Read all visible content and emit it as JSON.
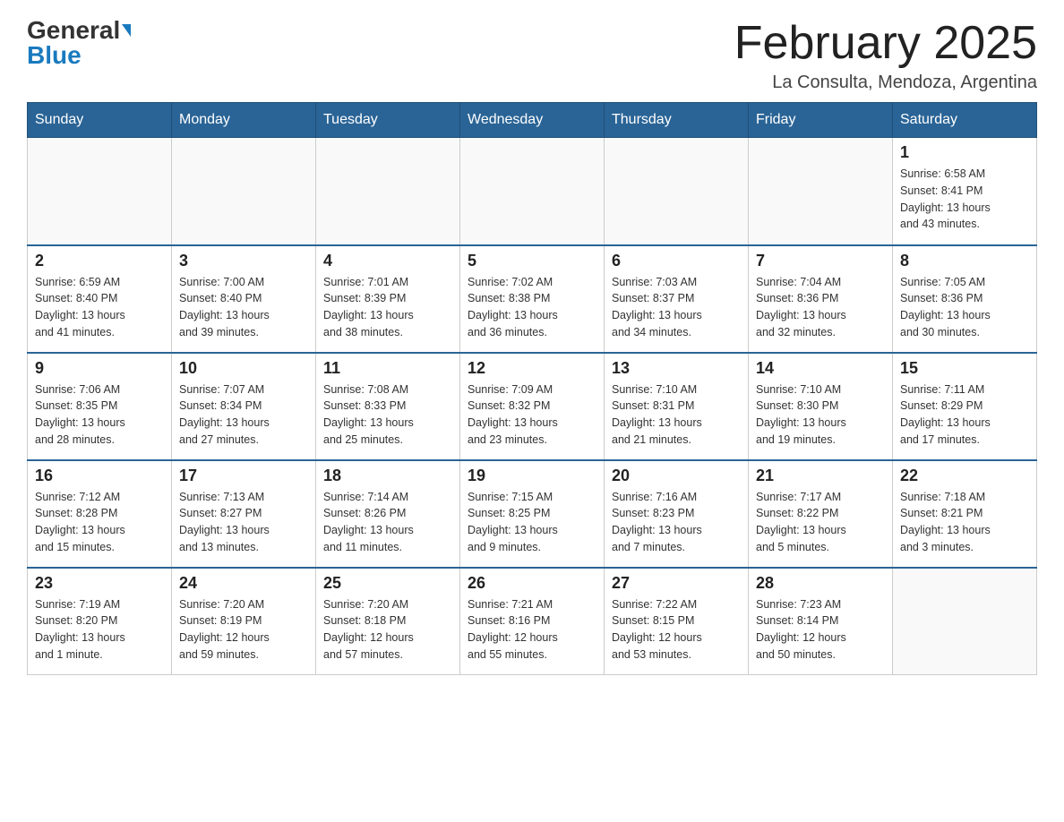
{
  "header": {
    "logo_general": "General",
    "logo_blue": "Blue",
    "title": "February 2025",
    "subtitle": "La Consulta, Mendoza, Argentina"
  },
  "days_of_week": [
    "Sunday",
    "Monday",
    "Tuesday",
    "Wednesday",
    "Thursday",
    "Friday",
    "Saturday"
  ],
  "weeks": [
    [
      {
        "day": "",
        "info": ""
      },
      {
        "day": "",
        "info": ""
      },
      {
        "day": "",
        "info": ""
      },
      {
        "day": "",
        "info": ""
      },
      {
        "day": "",
        "info": ""
      },
      {
        "day": "",
        "info": ""
      },
      {
        "day": "1",
        "info": "Sunrise: 6:58 AM\nSunset: 8:41 PM\nDaylight: 13 hours\nand 43 minutes."
      }
    ],
    [
      {
        "day": "2",
        "info": "Sunrise: 6:59 AM\nSunset: 8:40 PM\nDaylight: 13 hours\nand 41 minutes."
      },
      {
        "day": "3",
        "info": "Sunrise: 7:00 AM\nSunset: 8:40 PM\nDaylight: 13 hours\nand 39 minutes."
      },
      {
        "day": "4",
        "info": "Sunrise: 7:01 AM\nSunset: 8:39 PM\nDaylight: 13 hours\nand 38 minutes."
      },
      {
        "day": "5",
        "info": "Sunrise: 7:02 AM\nSunset: 8:38 PM\nDaylight: 13 hours\nand 36 minutes."
      },
      {
        "day": "6",
        "info": "Sunrise: 7:03 AM\nSunset: 8:37 PM\nDaylight: 13 hours\nand 34 minutes."
      },
      {
        "day": "7",
        "info": "Sunrise: 7:04 AM\nSunset: 8:36 PM\nDaylight: 13 hours\nand 32 minutes."
      },
      {
        "day": "8",
        "info": "Sunrise: 7:05 AM\nSunset: 8:36 PM\nDaylight: 13 hours\nand 30 minutes."
      }
    ],
    [
      {
        "day": "9",
        "info": "Sunrise: 7:06 AM\nSunset: 8:35 PM\nDaylight: 13 hours\nand 28 minutes."
      },
      {
        "day": "10",
        "info": "Sunrise: 7:07 AM\nSunset: 8:34 PM\nDaylight: 13 hours\nand 27 minutes."
      },
      {
        "day": "11",
        "info": "Sunrise: 7:08 AM\nSunset: 8:33 PM\nDaylight: 13 hours\nand 25 minutes."
      },
      {
        "day": "12",
        "info": "Sunrise: 7:09 AM\nSunset: 8:32 PM\nDaylight: 13 hours\nand 23 minutes."
      },
      {
        "day": "13",
        "info": "Sunrise: 7:10 AM\nSunset: 8:31 PM\nDaylight: 13 hours\nand 21 minutes."
      },
      {
        "day": "14",
        "info": "Sunrise: 7:10 AM\nSunset: 8:30 PM\nDaylight: 13 hours\nand 19 minutes."
      },
      {
        "day": "15",
        "info": "Sunrise: 7:11 AM\nSunset: 8:29 PM\nDaylight: 13 hours\nand 17 minutes."
      }
    ],
    [
      {
        "day": "16",
        "info": "Sunrise: 7:12 AM\nSunset: 8:28 PM\nDaylight: 13 hours\nand 15 minutes."
      },
      {
        "day": "17",
        "info": "Sunrise: 7:13 AM\nSunset: 8:27 PM\nDaylight: 13 hours\nand 13 minutes."
      },
      {
        "day": "18",
        "info": "Sunrise: 7:14 AM\nSunset: 8:26 PM\nDaylight: 13 hours\nand 11 minutes."
      },
      {
        "day": "19",
        "info": "Sunrise: 7:15 AM\nSunset: 8:25 PM\nDaylight: 13 hours\nand 9 minutes."
      },
      {
        "day": "20",
        "info": "Sunrise: 7:16 AM\nSunset: 8:23 PM\nDaylight: 13 hours\nand 7 minutes."
      },
      {
        "day": "21",
        "info": "Sunrise: 7:17 AM\nSunset: 8:22 PM\nDaylight: 13 hours\nand 5 minutes."
      },
      {
        "day": "22",
        "info": "Sunrise: 7:18 AM\nSunset: 8:21 PM\nDaylight: 13 hours\nand 3 minutes."
      }
    ],
    [
      {
        "day": "23",
        "info": "Sunrise: 7:19 AM\nSunset: 8:20 PM\nDaylight: 13 hours\nand 1 minute."
      },
      {
        "day": "24",
        "info": "Sunrise: 7:20 AM\nSunset: 8:19 PM\nDaylight: 12 hours\nand 59 minutes."
      },
      {
        "day": "25",
        "info": "Sunrise: 7:20 AM\nSunset: 8:18 PM\nDaylight: 12 hours\nand 57 minutes."
      },
      {
        "day": "26",
        "info": "Sunrise: 7:21 AM\nSunset: 8:16 PM\nDaylight: 12 hours\nand 55 minutes."
      },
      {
        "day": "27",
        "info": "Sunrise: 7:22 AM\nSunset: 8:15 PM\nDaylight: 12 hours\nand 53 minutes."
      },
      {
        "day": "28",
        "info": "Sunrise: 7:23 AM\nSunset: 8:14 PM\nDaylight: 12 hours\nand 50 minutes."
      },
      {
        "day": "",
        "info": ""
      }
    ]
  ]
}
